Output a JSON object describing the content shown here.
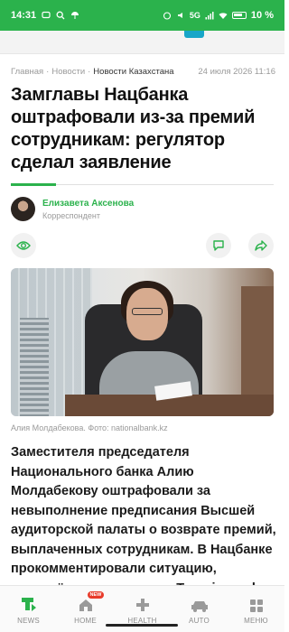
{
  "status_bar": {
    "time": "14:31",
    "battery_pct": "10 %",
    "network": "5G"
  },
  "breadcrumb": {
    "items": [
      "Главная",
      "Новости",
      "Новости Казахстана"
    ],
    "date": "24 июля 2026 11:16"
  },
  "article": {
    "title": "Замглавы Нацбанка оштрафовали из-за премий сотрудникам: регулятор сделал заявление",
    "author_name": "Елизавета Аксенова",
    "author_role": "Корреспондент",
    "photo_caption": "Алия Молдабекова. Фото: nationalbank.kz",
    "lead": "Заместителя председателя Национального банка Алию Молдабекову оштрафовали за невыполнение предписания Высшей аудиторской палаты о возврате премий, выплаченных сотрудникам. В Нацбанке прокомментировали ситуацию, передаёт корреспондент Tengrinews.kz."
  },
  "bottom_nav": {
    "items": [
      {
        "label": "NEWS"
      },
      {
        "label": "HOME",
        "badge": "NEW"
      },
      {
        "label": "HEALTH"
      },
      {
        "label": "AUTO"
      },
      {
        "label": "МЕНЮ"
      }
    ]
  },
  "colors": {
    "brand": "#2bb24c",
    "badge": "#e83b2a"
  }
}
